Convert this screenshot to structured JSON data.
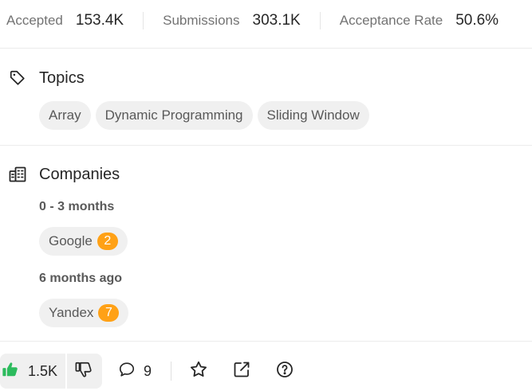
{
  "stats": {
    "accepted_label": "Accepted",
    "accepted_value": "153.4K",
    "submissions_label": "Submissions",
    "submissions_value": "303.1K",
    "acceptance_label": "Acceptance Rate",
    "acceptance_value": "50.6%"
  },
  "topics": {
    "title": "Topics",
    "icon": "tag-icon",
    "tags": [
      "Array",
      "Dynamic Programming",
      "Sliding Window"
    ]
  },
  "companies": {
    "title": "Companies",
    "icon": "building-icon",
    "groups": [
      {
        "period": "0 - 3 months",
        "items": [
          {
            "name": "Google",
            "count": "2"
          }
        ]
      },
      {
        "period": "6 months ago",
        "items": [
          {
            "name": "Yandex",
            "count": "7"
          }
        ]
      }
    ]
  },
  "bottom_bar": {
    "likes": "1.5K",
    "comments": "9",
    "icons": [
      "thumbs-up-icon",
      "thumbs-down-icon",
      "comment-icon",
      "star-icon",
      "share-icon",
      "help-icon"
    ]
  },
  "colors": {
    "accent_orange": "#ffa116",
    "like_green": "#2cbb5d",
    "chip_background": "#f0f0f0",
    "muted_text": "#737373"
  }
}
